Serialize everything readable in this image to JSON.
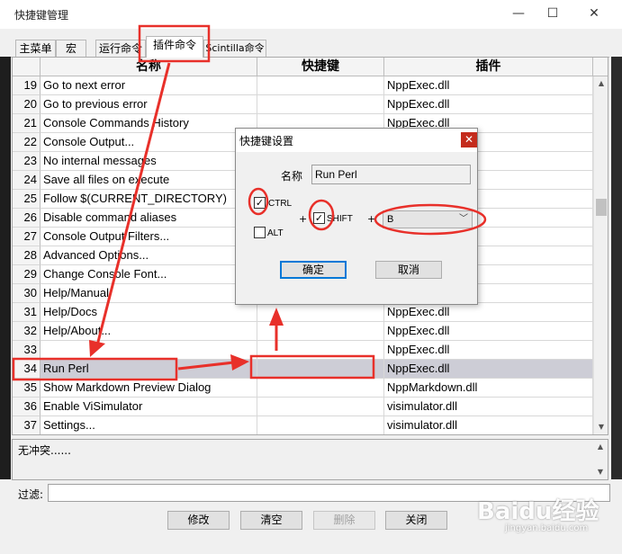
{
  "window": {
    "title": "快捷键管理",
    "minimize_glyph": "—",
    "maximize_glyph": "☐",
    "close_glyph": "✕"
  },
  "tabs": [
    {
      "label": "主菜单",
      "active": false
    },
    {
      "label": "宏",
      "active": false
    },
    {
      "label": "运行命令",
      "active": false
    },
    {
      "label": "插件命令",
      "active": true
    },
    {
      "label": "Scintilla命令",
      "active": false
    }
  ],
  "grid": {
    "columns": [
      "名称",
      "快捷键",
      "插件"
    ],
    "rows": [
      {
        "num": "19",
        "name": "Go to next error",
        "shortcut": "",
        "plugin": "NppExec.dll"
      },
      {
        "num": "20",
        "name": "Go to previous error",
        "shortcut": "",
        "plugin": "NppExec.dll"
      },
      {
        "num": "21",
        "name": "Console Commands History",
        "shortcut": "",
        "plugin": "NppExec.dll"
      },
      {
        "num": "22",
        "name": "Console Output...",
        "shortcut": "",
        "plugin": ""
      },
      {
        "num": "23",
        "name": "No internal messages",
        "shortcut": "",
        "plugin": ""
      },
      {
        "num": "24",
        "name": "Save all files on execute",
        "shortcut": "",
        "plugin": ""
      },
      {
        "num": "25",
        "name": "Follow $(CURRENT_DIRECTORY)",
        "shortcut": "",
        "plugin": ""
      },
      {
        "num": "26",
        "name": "Disable command aliases",
        "shortcut": "",
        "plugin": ""
      },
      {
        "num": "27",
        "name": "Console Output Filters...",
        "shortcut": "",
        "plugin": ""
      },
      {
        "num": "28",
        "name": "Advanced Options...",
        "shortcut": "",
        "plugin": ""
      },
      {
        "num": "29",
        "name": "Change Console Font...",
        "shortcut": "",
        "plugin": ""
      },
      {
        "num": "30",
        "name": "Help/Manual",
        "shortcut": "",
        "plugin": ""
      },
      {
        "num": "31",
        "name": "Help/Docs",
        "shortcut": "",
        "plugin": "NppExec.dll"
      },
      {
        "num": "32",
        "name": "Help/About...",
        "shortcut": "",
        "plugin": "NppExec.dll"
      },
      {
        "num": "33",
        "name": "",
        "shortcut": "",
        "plugin": "NppExec.dll"
      },
      {
        "num": "34",
        "name": "Run Perl",
        "shortcut": "",
        "plugin": "NppExec.dll",
        "selected": true
      },
      {
        "num": "35",
        "name": "Show Markdown Preview Dialog",
        "shortcut": "",
        "plugin": "NppMarkdown.dll"
      },
      {
        "num": "36",
        "name": "Enable ViSimulator",
        "shortcut": "",
        "plugin": "visimulator.dll"
      },
      {
        "num": "37",
        "name": "Settings...",
        "shortcut": "",
        "plugin": "visimulator.dll"
      }
    ]
  },
  "conflict_text": "无冲突......",
  "filter": {
    "label": "过滤:",
    "value": ""
  },
  "buttons": {
    "modify": "修改",
    "clear": "清空",
    "delete": "删除",
    "close": "关闭"
  },
  "dialog": {
    "title": "快捷键设置",
    "close_glyph": "✕",
    "name_label": "名称",
    "name_value": "Run Perl",
    "ctrl_label": "CTRL",
    "ctrl_checked": true,
    "alt_label": "ALT",
    "alt_checked": false,
    "shift_label": "SHIFT",
    "shift_checked": true,
    "plus": "+",
    "key_value": "B",
    "ok_label": "确定",
    "cancel_label": "取消"
  },
  "annotation_color": "#e8302a",
  "watermark": {
    "main": "Baidu经验",
    "sub": "jingyan.baidu.com"
  }
}
